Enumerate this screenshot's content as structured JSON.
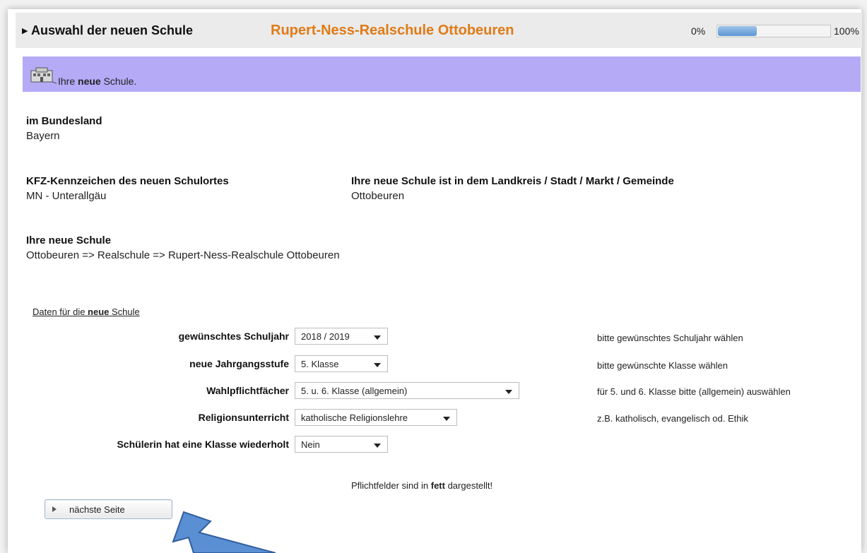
{
  "header": {
    "title": "Auswahl der neuen Schule",
    "school_name": "Rupert-Ness-Realschule Ottobeuren",
    "progress_start_label": "0%",
    "progress_end_label": "100%",
    "progress_value_percent": 35
  },
  "banner": {
    "icon": "building-icon",
    "text_prefix": "Ihre ",
    "text_bold": "neue",
    "text_suffix": " Schule."
  },
  "bundesland": {
    "label": "im Bundesland",
    "value": "Bayern"
  },
  "kfz": {
    "label": "KFZ-Kennzeichen des neuen Schulortes",
    "value": "MN - Unterallgäu"
  },
  "landkreis": {
    "label": "Ihre neue Schule ist in dem Landkreis / Stadt / Markt / Gemeinde",
    "value": "Ottobeuren"
  },
  "schule": {
    "label": "Ihre neue Schule",
    "value": "Ottobeuren => Realschule => Rupert-Ness-Realschule Ottobeuren"
  },
  "data_section": {
    "prefix": "Daten für die ",
    "bold": "neue",
    "suffix": " Schule"
  },
  "fields": [
    {
      "label": "gewünschtes Schuljahr",
      "value": "2018 / 2019",
      "hint": "bitte gewünschtes Schuljahr wählen"
    },
    {
      "label": "neue Jahrgangsstufe",
      "value": "5. Klasse",
      "hint": "bitte gewünschte Klasse wählen"
    },
    {
      "label": "Wahlpflichtfächer",
      "value": "5. u. 6. Klasse (allgemein)",
      "hint": "für 5. und 6. Klasse bitte (allgemein) auswählen"
    },
    {
      "label": "Religionsunterricht",
      "value": "katholische Religionslehre",
      "hint": "z.B. katholisch, evangelisch od. Ethik"
    },
    {
      "label": "Schülerin hat eine Klasse wiederholt",
      "value": "Nein",
      "hint": ""
    }
  ],
  "footnote": {
    "prefix": "Pflichtfelder sind in ",
    "bold": "fett",
    "suffix": " dargestellt!"
  },
  "next_button": {
    "label": "nächste Seite",
    "icon": "play-arrow-icon"
  },
  "colors": {
    "school_name": "#e07b16",
    "banner_bg": "#b4aaf6",
    "progress_fill": "#5e95d4",
    "pointer_arrow": "#5b8fd3"
  }
}
